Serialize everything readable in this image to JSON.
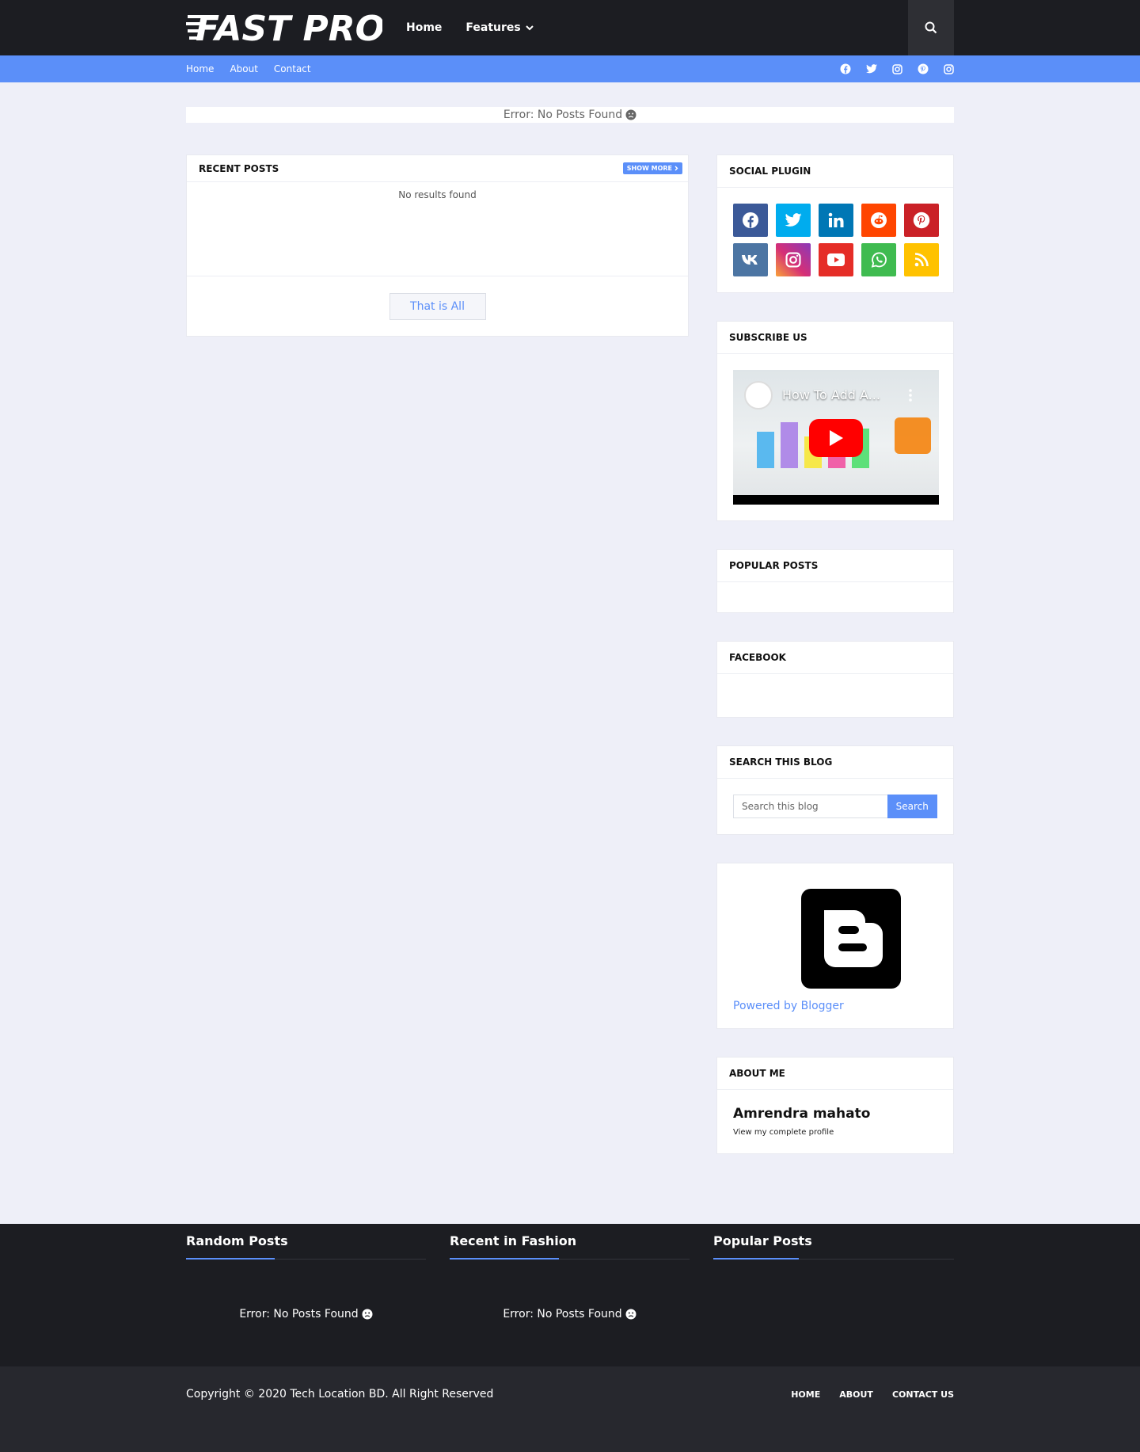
{
  "header": {
    "logo_text": "FAST PRO",
    "nav": [
      {
        "label": "Home"
      },
      {
        "label": "Features"
      }
    ]
  },
  "subnav": {
    "links": [
      {
        "label": "Home"
      },
      {
        "label": "About"
      },
      {
        "label": "Contact"
      }
    ],
    "social_icons": [
      "facebook-icon",
      "twitter-icon",
      "instagram-icon",
      "pinterest-icon",
      "instagram-icon"
    ]
  },
  "error_bar": {
    "text": "Error: No Posts Found"
  },
  "recent_posts": {
    "title": "RECENT POSTS",
    "show_more": "SHOW MORE",
    "empty_text": "No results found",
    "that_is_all": "That is All"
  },
  "sidebar": {
    "social_plugin": {
      "title": "SOCIAL PLUGIN",
      "icons": [
        {
          "name": "facebook",
          "color": "#3b5998"
        },
        {
          "name": "twitter",
          "color": "#00acee"
        },
        {
          "name": "linkedin",
          "color": "#0077b5"
        },
        {
          "name": "reddit",
          "color": "#ff4500"
        },
        {
          "name": "pinterest",
          "color": "#ca2127"
        },
        {
          "name": "vk",
          "color": "#4c75a3"
        },
        {
          "name": "instagram",
          "color": "#c13584"
        },
        {
          "name": "youtube",
          "color": "#e52d27"
        },
        {
          "name": "whatsapp",
          "color": "#3fbb50"
        },
        {
          "name": "rss",
          "color": "#ffc200"
        }
      ]
    },
    "subscribe": {
      "title": "SUBSCRIBE US",
      "video_title": "How To Add A..."
    },
    "popular_posts": {
      "title": "POPULAR POSTS"
    },
    "facebook": {
      "title": "FACEBOOK"
    },
    "search": {
      "title": "SEARCH THIS BLOG",
      "placeholder": "Search this blog",
      "button": "Search"
    },
    "blogger": {
      "powered": "Powered by Blogger"
    },
    "about": {
      "title": "ABOUT ME",
      "name": "Amrendra mahato",
      "link": "View my complete profile"
    }
  },
  "footer": {
    "columns": [
      {
        "title": "Random Posts",
        "text": "Error: No Posts Found"
      },
      {
        "title": "Recent in Fashion",
        "text": "Error: No Posts Found"
      },
      {
        "title": "Popular Posts",
        "text": ""
      }
    ],
    "copyright": "Copyright © 2020 Tech Location BD. All Right Reserved",
    "nav": [
      {
        "label": "HOME"
      },
      {
        "label": "ABOUT"
      },
      {
        "label": "CONTACT US"
      }
    ]
  },
  "colors": {
    "accent": "#5b8ff9",
    "header_bg": "#1c1d22",
    "page_bg": "#eeeff8"
  }
}
